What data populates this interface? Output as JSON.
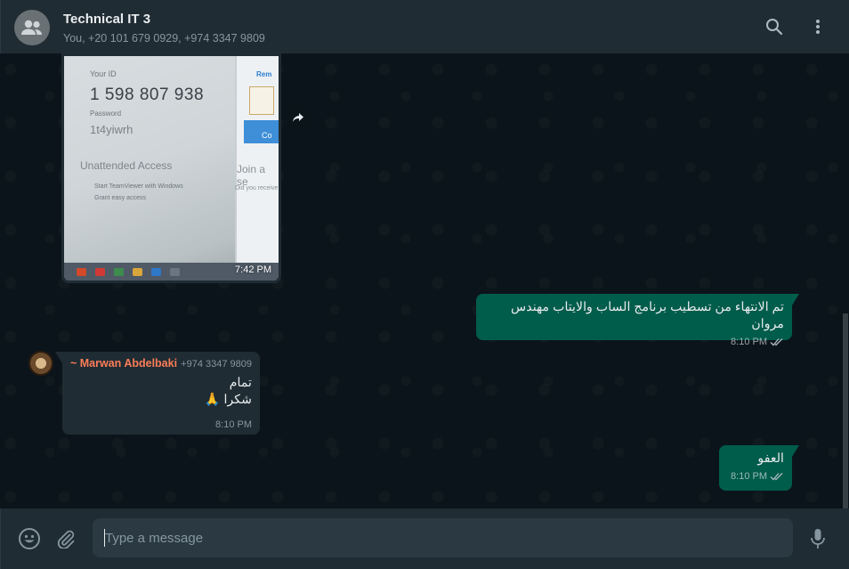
{
  "header": {
    "title": "Technical IT 3",
    "members": "You, +20 101 679 0929, +974 3347 9809",
    "icons": {
      "avatar": "group-icon",
      "search": "search-icon",
      "menu": "kebab-menu-icon"
    }
  },
  "messages": {
    "image_message": {
      "time": "7:42 PM",
      "photo": {
        "your_id_label": "Your ID",
        "id_value": "1 598 807 938",
        "password_label": "Password",
        "password_value": "1t4yiwrh",
        "unattended_access": "Unattended Access",
        "start_option": "Start TeamViewer with Windows",
        "grant_option": "Grant easy access",
        "remote_label": "Rem",
        "join_label": "Join a se",
        "did_label": "Did you receive",
        "connect_label": "Co"
      }
    },
    "outgoing_1": {
      "text": "تم الانتهاء من تسطيب برنامج الساب والايتاب مهندس مروان",
      "time": "8:10 PM"
    },
    "incoming_1": {
      "sender_name": "~ Marwan Abdelbaki",
      "sender_phone": "+974 3347 9809",
      "line_1": "تمام",
      "line_2": "شكرا 🙏",
      "time": "8:10 PM"
    },
    "outgoing_2": {
      "text": "العفو",
      "time": "8:10 PM"
    }
  },
  "footer": {
    "placeholder": "Type a message",
    "icons": {
      "emoji": "emoji-icon",
      "attach": "paperclip-icon",
      "mic": "microphone-icon"
    }
  },
  "colors": {
    "header_bg": "#202c33",
    "chat_bg": "#0b141a",
    "outgoing_bubble": "#005c4b",
    "incoming_bubble": "#202c33",
    "sender_name": "#fa7d58"
  }
}
